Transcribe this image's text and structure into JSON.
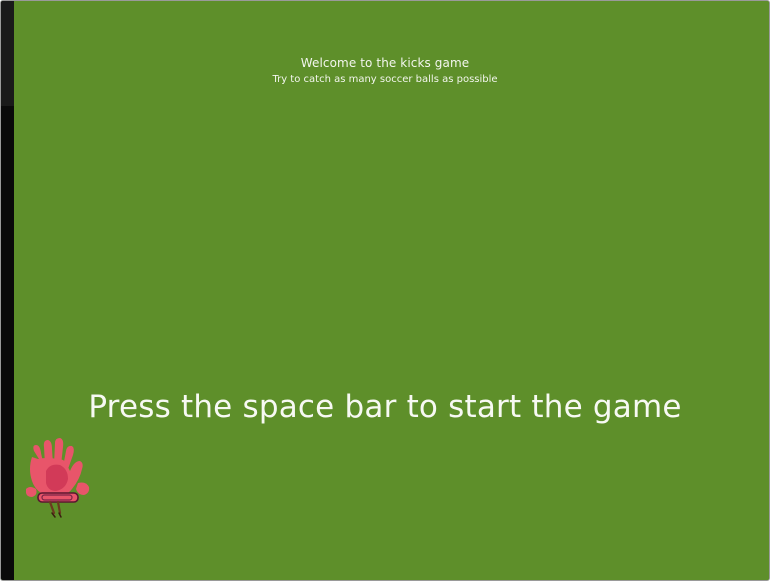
{
  "game": {
    "welcome_title": "Welcome to the kicks game",
    "welcome_subtitle": "Try to catch as many soccer balls as possible",
    "start_prompt": "Press the space bar to start the game"
  },
  "colors": {
    "field_background": "#5e8f2a",
    "text": "#f3f6ee",
    "glove": "#e8556a",
    "glove_dark": "#d23a58",
    "left_edge": "#0a0a0a"
  },
  "sprites": {
    "player": "goalkeeper-glove-icon"
  }
}
